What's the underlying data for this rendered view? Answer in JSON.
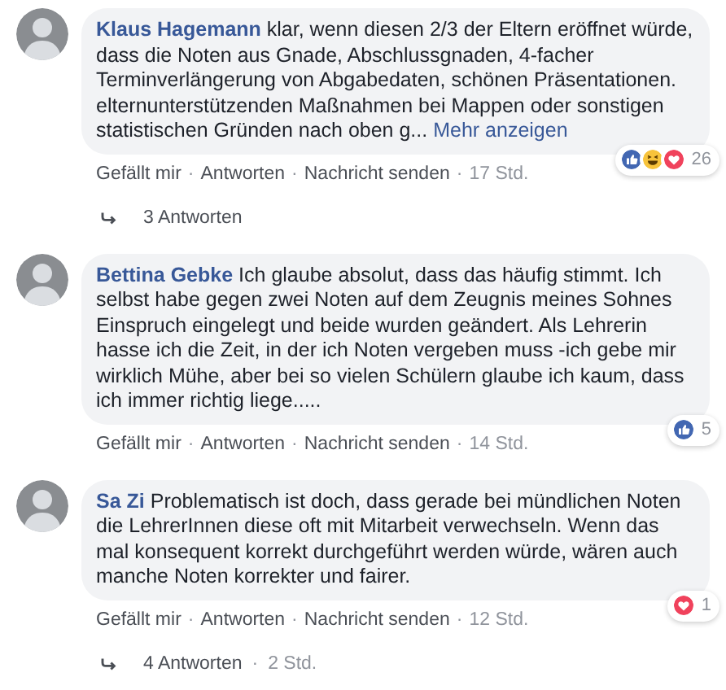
{
  "separator": "·",
  "comments": [
    {
      "author": "Klaus Hagemann",
      "text": "klar, wenn diesen 2/3 der Eltern eröffnet würde, dass die Noten aus Gnade, Abschlussgnaden, 4-facher Terminverlängerung von Abgabedaten, schönen Präsentationen. elternunterstützenden Maßnahmen bei Mappen oder sonstigen statistischen Gründen nach oben g...",
      "more": "Mehr anzeigen",
      "reactions": [
        {
          "kind": "like"
        },
        {
          "kind": "haha"
        },
        {
          "kind": "love"
        }
      ],
      "reaction_count": "26",
      "actions": [
        "Gefällt mir",
        "Antworten",
        "Nachricht senden"
      ],
      "time": "17 Std.",
      "replies": {
        "label": "3 Antworten"
      }
    },
    {
      "author": "Bettina Gebke",
      "text": "Ich glaube absolut, dass das häufig stimmt. Ich selbst habe gegen zwei Noten auf dem Zeugnis meines Sohnes Einspruch eingelegt und beide wurden geändert. Als Lehrerin hasse ich die Zeit, in der ich Noten vergeben muss -ich gebe mir wirklich Mühe, aber bei so vielen Schülern glaube ich kaum, dass ich immer richtig liege.....",
      "reactions": [
        {
          "kind": "like"
        }
      ],
      "reaction_count": "5",
      "actions": [
        "Gefällt mir",
        "Antworten",
        "Nachricht senden"
      ],
      "time": "14 Std."
    },
    {
      "author": "Sa Zi",
      "text": "Problematisch ist doch, dass gerade bei mündlichen Noten die LehrerInnen diese oft mit Mitarbeit verwechseln. Wenn das mal konsequent korrekt durchgeführt werden würde, wären auch manche Noten korrekter und fairer.",
      "reactions": [
        {
          "kind": "love"
        }
      ],
      "reaction_count": "1",
      "actions": [
        "Gefällt mir",
        "Antworten",
        "Nachricht senden"
      ],
      "time": "12 Std.",
      "replies": {
        "label": "4 Antworten",
        "time": "2 Std."
      }
    }
  ]
}
